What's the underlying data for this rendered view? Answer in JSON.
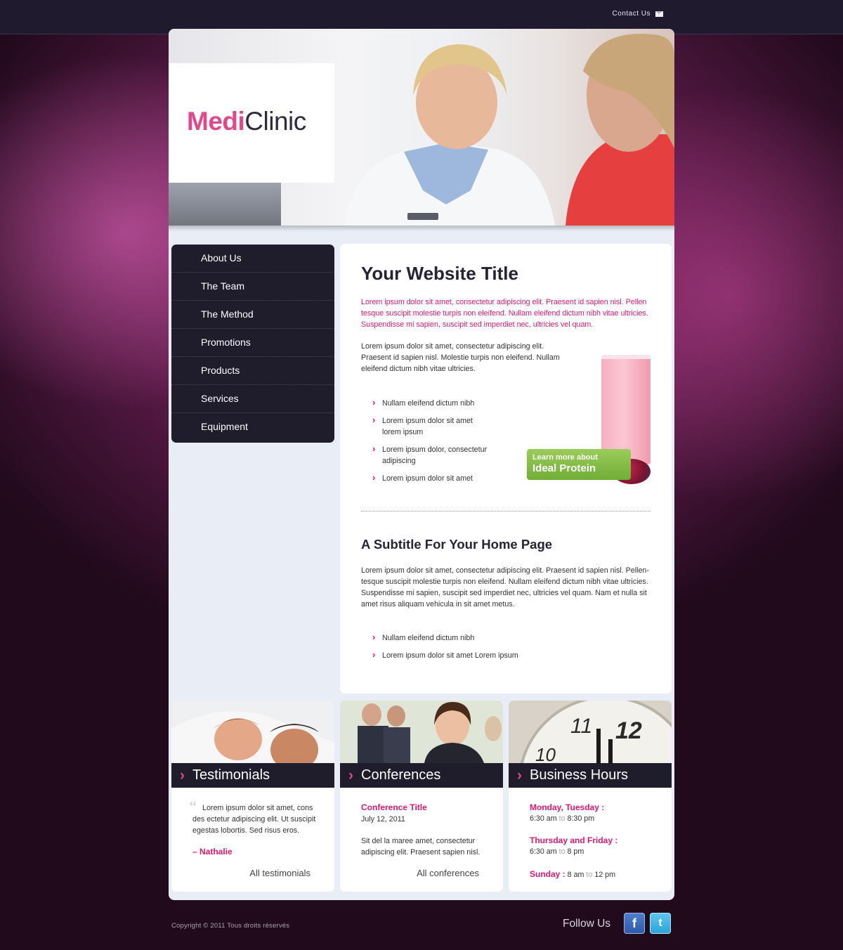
{
  "header": {
    "contact_label": "Contact Us",
    "contact_icon": "mail-icon"
  },
  "logo": {
    "part1": "Medi",
    "part2": "Clinic"
  },
  "nav": {
    "items": [
      {
        "label": "About Us"
      },
      {
        "label": "The Team"
      },
      {
        "label": "The Method"
      },
      {
        "label": "Promotions"
      },
      {
        "label": "Products"
      },
      {
        "label": "Services"
      },
      {
        "label": "Equipment"
      }
    ]
  },
  "main": {
    "title": "Your Website Title",
    "intro": "Lorem ipsum dolor sit amet, consectetur adipiscing elit. Praesent id sapien nisl. Pellen tesque suscipit molestie turpis non eleifend. Nullam eleifend dictum nibh vitae ultricies. Suspendisse mi sapien, suscipit sed imperdiet nec, ultricies vel quam.",
    "paragraph1": "Lorem ipsum dolor sit amet, consectetur adipiscing elit. Praesent id sapien nisl. Molestie turpis non eleifend. Nullam eleifend dictum nibh vitae ultricies.",
    "bullets1": [
      "Nullam eleifend dictum nibh",
      "Lorem ipsum dolor sit amet lorem ipsum",
      "Lorem ipsum dolor, consectetur adipiscing",
      "Lorem ipsum dolor sit amet"
    ],
    "promo": {
      "line1": "Learn more about",
      "line2": "Ideal Protein"
    },
    "subtitle": "A Subtitle For Your Home Page",
    "paragraph2": "Lorem ipsum dolor sit amet, consectetur adipiscing elit. Praesent id sapien nisl. Pellen-tesque suscipit molestie turpis non eleifend. Nullam eleifend dictum nibh vitae ultricies. Suspendisse mi sapien, suscipit sed imperdiet nec, ultricies vel quam. Nam et nulla sit amet risus aliquam vehicula in sit amet metus.",
    "bullets2": [
      "Nullam eleifend dictum nibh",
      "Lorem ipsum dolor sit amet Lorem ipsum"
    ]
  },
  "testimonials": {
    "heading": "Testimonials",
    "quote": "Lorem ipsum dolor sit amet, cons des ectetur adipiscing elit. Ut suscipit egestas lobortis. Sed risus eros.",
    "author": "– Nathalie",
    "link": "All testimonials"
  },
  "conferences": {
    "heading": "Conferences",
    "conf_title": "Conference Title",
    "date": "July 12, 2011",
    "text": "Sit del la maree amet, consectetur adipiscing elit. Praesent sapien nisl.",
    "link": "All conferences"
  },
  "hours": {
    "heading": "Business Hours",
    "rows": [
      {
        "days": "Monday, Tuesday :",
        "open": "6:30 am",
        "to": "to",
        "close": "8:30 pm"
      },
      {
        "days": "Thursday and Friday :",
        "open": "6:30 am",
        "to": "to",
        "close": "8 pm"
      }
    ],
    "sunday": {
      "days": "Sunday :",
      "open": "8 am",
      "to": "to",
      "close": "12 pm"
    },
    "clock_numbers": [
      "11",
      "12",
      "10"
    ]
  },
  "footer": {
    "copyright": "Copyright © 2011 Tous droits réservés",
    "follow": "Follow Us",
    "facebook_glyph": "f",
    "twitter_glyph": "t"
  },
  "colors": {
    "accent": "#e2186f",
    "nav_bg": "#1f1c2c",
    "page_bg": "#e9edf5"
  }
}
